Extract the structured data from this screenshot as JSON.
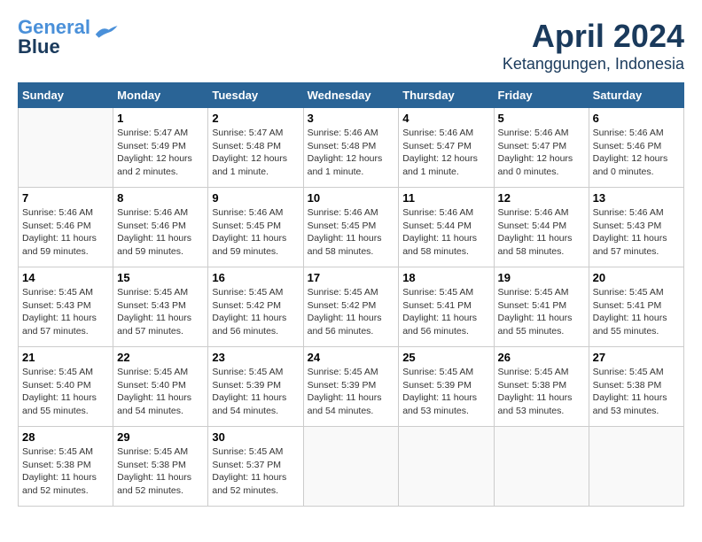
{
  "logo": {
    "line1": "General",
    "line2": "Blue"
  },
  "title": "April 2024",
  "location": "Ketanggungen, Indonesia",
  "days_of_week": [
    "Sunday",
    "Monday",
    "Tuesday",
    "Wednesday",
    "Thursday",
    "Friday",
    "Saturday"
  ],
  "weeks": [
    [
      {
        "day": "",
        "info": ""
      },
      {
        "day": "1",
        "info": "Sunrise: 5:47 AM\nSunset: 5:49 PM\nDaylight: 12 hours\nand 2 minutes."
      },
      {
        "day": "2",
        "info": "Sunrise: 5:47 AM\nSunset: 5:48 PM\nDaylight: 12 hours\nand 1 minute."
      },
      {
        "day": "3",
        "info": "Sunrise: 5:46 AM\nSunset: 5:48 PM\nDaylight: 12 hours\nand 1 minute."
      },
      {
        "day": "4",
        "info": "Sunrise: 5:46 AM\nSunset: 5:47 PM\nDaylight: 12 hours\nand 1 minute."
      },
      {
        "day": "5",
        "info": "Sunrise: 5:46 AM\nSunset: 5:47 PM\nDaylight: 12 hours\nand 0 minutes."
      },
      {
        "day": "6",
        "info": "Sunrise: 5:46 AM\nSunset: 5:46 PM\nDaylight: 12 hours\nand 0 minutes."
      }
    ],
    [
      {
        "day": "7",
        "info": "Sunrise: 5:46 AM\nSunset: 5:46 PM\nDaylight: 11 hours\nand 59 minutes."
      },
      {
        "day": "8",
        "info": "Sunrise: 5:46 AM\nSunset: 5:46 PM\nDaylight: 11 hours\nand 59 minutes."
      },
      {
        "day": "9",
        "info": "Sunrise: 5:46 AM\nSunset: 5:45 PM\nDaylight: 11 hours\nand 59 minutes."
      },
      {
        "day": "10",
        "info": "Sunrise: 5:46 AM\nSunset: 5:45 PM\nDaylight: 11 hours\nand 58 minutes."
      },
      {
        "day": "11",
        "info": "Sunrise: 5:46 AM\nSunset: 5:44 PM\nDaylight: 11 hours\nand 58 minutes."
      },
      {
        "day": "12",
        "info": "Sunrise: 5:46 AM\nSunset: 5:44 PM\nDaylight: 11 hours\nand 58 minutes."
      },
      {
        "day": "13",
        "info": "Sunrise: 5:46 AM\nSunset: 5:43 PM\nDaylight: 11 hours\nand 57 minutes."
      }
    ],
    [
      {
        "day": "14",
        "info": "Sunrise: 5:45 AM\nSunset: 5:43 PM\nDaylight: 11 hours\nand 57 minutes."
      },
      {
        "day": "15",
        "info": "Sunrise: 5:45 AM\nSunset: 5:43 PM\nDaylight: 11 hours\nand 57 minutes."
      },
      {
        "day": "16",
        "info": "Sunrise: 5:45 AM\nSunset: 5:42 PM\nDaylight: 11 hours\nand 56 minutes."
      },
      {
        "day": "17",
        "info": "Sunrise: 5:45 AM\nSunset: 5:42 PM\nDaylight: 11 hours\nand 56 minutes."
      },
      {
        "day": "18",
        "info": "Sunrise: 5:45 AM\nSunset: 5:41 PM\nDaylight: 11 hours\nand 56 minutes."
      },
      {
        "day": "19",
        "info": "Sunrise: 5:45 AM\nSunset: 5:41 PM\nDaylight: 11 hours\nand 55 minutes."
      },
      {
        "day": "20",
        "info": "Sunrise: 5:45 AM\nSunset: 5:41 PM\nDaylight: 11 hours\nand 55 minutes."
      }
    ],
    [
      {
        "day": "21",
        "info": "Sunrise: 5:45 AM\nSunset: 5:40 PM\nDaylight: 11 hours\nand 55 minutes."
      },
      {
        "day": "22",
        "info": "Sunrise: 5:45 AM\nSunset: 5:40 PM\nDaylight: 11 hours\nand 54 minutes."
      },
      {
        "day": "23",
        "info": "Sunrise: 5:45 AM\nSunset: 5:39 PM\nDaylight: 11 hours\nand 54 minutes."
      },
      {
        "day": "24",
        "info": "Sunrise: 5:45 AM\nSunset: 5:39 PM\nDaylight: 11 hours\nand 54 minutes."
      },
      {
        "day": "25",
        "info": "Sunrise: 5:45 AM\nSunset: 5:39 PM\nDaylight: 11 hours\nand 53 minutes."
      },
      {
        "day": "26",
        "info": "Sunrise: 5:45 AM\nSunset: 5:38 PM\nDaylight: 11 hours\nand 53 minutes."
      },
      {
        "day": "27",
        "info": "Sunrise: 5:45 AM\nSunset: 5:38 PM\nDaylight: 11 hours\nand 53 minutes."
      }
    ],
    [
      {
        "day": "28",
        "info": "Sunrise: 5:45 AM\nSunset: 5:38 PM\nDaylight: 11 hours\nand 52 minutes."
      },
      {
        "day": "29",
        "info": "Sunrise: 5:45 AM\nSunset: 5:38 PM\nDaylight: 11 hours\nand 52 minutes."
      },
      {
        "day": "30",
        "info": "Sunrise: 5:45 AM\nSunset: 5:37 PM\nDaylight: 11 hours\nand 52 minutes."
      },
      {
        "day": "",
        "info": ""
      },
      {
        "day": "",
        "info": ""
      },
      {
        "day": "",
        "info": ""
      },
      {
        "day": "",
        "info": ""
      }
    ]
  ]
}
